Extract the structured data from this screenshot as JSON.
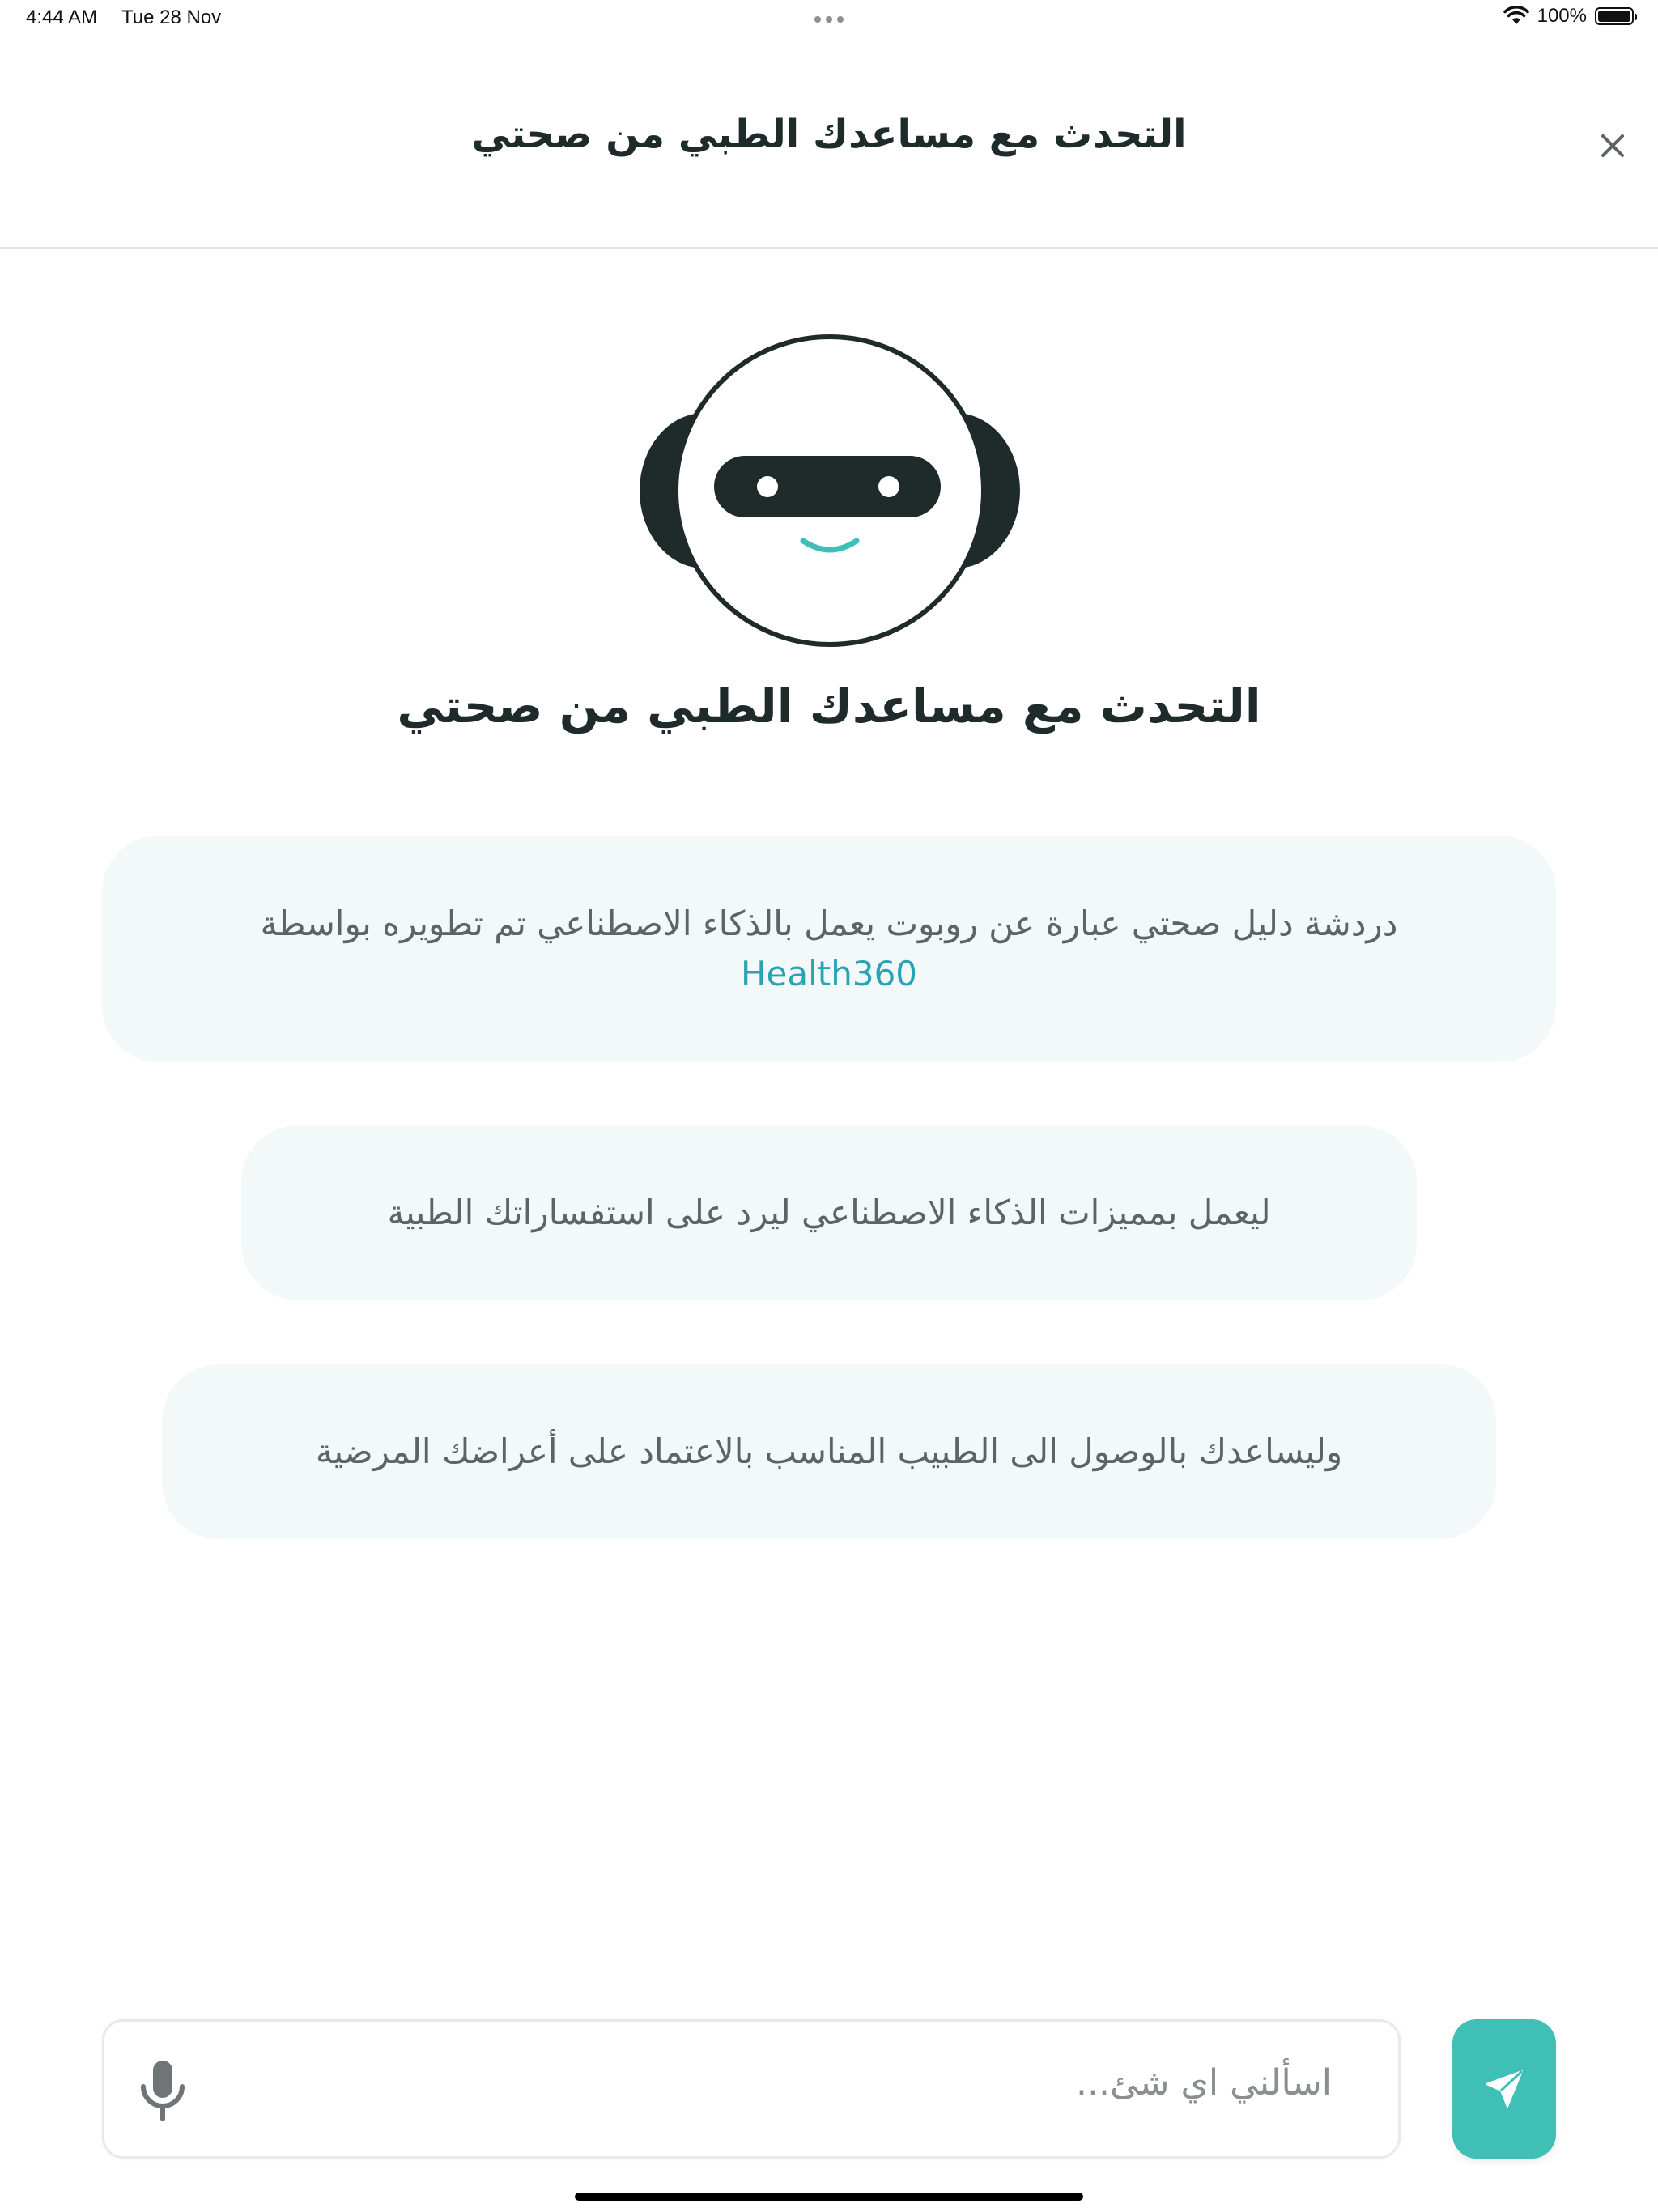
{
  "status_bar": {
    "time": "4:44 AM",
    "date": "Tue 28 Nov",
    "battery": "100%",
    "icons": [
      "wifi-icon",
      "battery-icon",
      "more-dots-icon"
    ]
  },
  "header": {
    "title": "التحدث مع مساعدك الطبي من صحتي",
    "close_icon": "close-icon"
  },
  "hero": {
    "avatar_icon": "robot-icon",
    "title": "التحدث مع مساعدك الطبي من صحتي"
  },
  "info": {
    "bubble1_text": "دردشة دليل صحتي عبارة عن روبوت يعمل بالذكاء الاصطناعي تم تطويره بواسطة",
    "bubble1_brand": "Health360",
    "bubble2_text": "ليعمل بمميزات الذكاء الاصطناعي ليرد على استفساراتك الطبية",
    "bubble3_text": "وليساعدك بالوصول الى الطبيب المناسب بالاعتماد على أعراضك المرضية"
  },
  "composer": {
    "placeholder": "اسألني اي شئ...",
    "mic_icon": "microphone-icon",
    "send_icon": "send-icon"
  },
  "colors": {
    "accent": "#3fbfb6",
    "brand_link": "#2aa3b5",
    "bubble_bg": "#f2f9f8",
    "title_text": "#1f2b2b",
    "robot_dark": "#1f2b2b"
  }
}
